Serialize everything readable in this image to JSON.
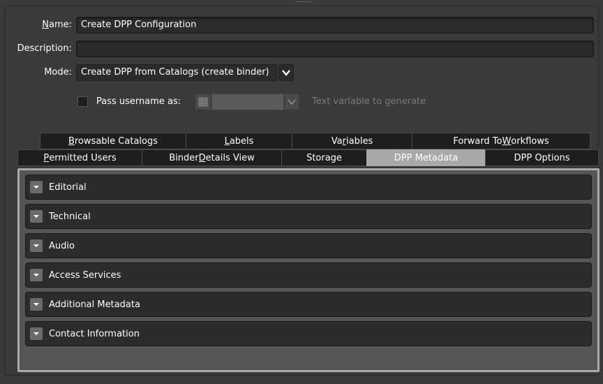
{
  "form": {
    "name_label_u": "N",
    "name_label_rest": "ame:",
    "name_value": "Create DPP Configuration",
    "description_label": "Description:",
    "description_value": "",
    "mode_label": "Mode:",
    "mode_value": "Create DPP from Catalogs (create binder)",
    "pass_username_label": "Pass username as:",
    "pass_username_checked": false,
    "variable_value": "",
    "variable_hint": "Text variable to generate"
  },
  "tabs_row1": [
    {
      "pre": "",
      "u": "B",
      "post": "rowsable Catalogs"
    },
    {
      "pre": "",
      "u": "L",
      "post": "abels"
    },
    {
      "pre": "Va",
      "u": "r",
      "post": "iables"
    },
    {
      "pre": "Forward To ",
      "u": "W",
      "post": "orkflows"
    }
  ],
  "tabs_row2": [
    {
      "pre": "",
      "u": "P",
      "post": "ermitted Users"
    },
    {
      "pre": "Binder ",
      "u": "D",
      "post": "etails View"
    },
    {
      "pre": "Storage",
      "u": "",
      "post": ""
    },
    {
      "pre": "DPP Metadata",
      "u": "",
      "post": ""
    },
    {
      "pre": "DPP Options",
      "u": "",
      "post": ""
    }
  ],
  "active_tab": "DPP Metadata",
  "sections": [
    {
      "label": "Editorial"
    },
    {
      "label": "Technical"
    },
    {
      "label": "Audio"
    },
    {
      "label": "Access Services"
    },
    {
      "label": "Additional Metadata"
    },
    {
      "label": "Contact Information"
    }
  ],
  "icons": {
    "section_toggle": "caret-down-icon",
    "mode_dropdown": "chevron-down-icon",
    "variable_type": "variable-grid-icon"
  },
  "colors": {
    "background": "#3a3a3a",
    "active_tab": "#a9a9a9",
    "section_bg": "#2c2c2c",
    "hint_text": "#7a7a7a"
  }
}
